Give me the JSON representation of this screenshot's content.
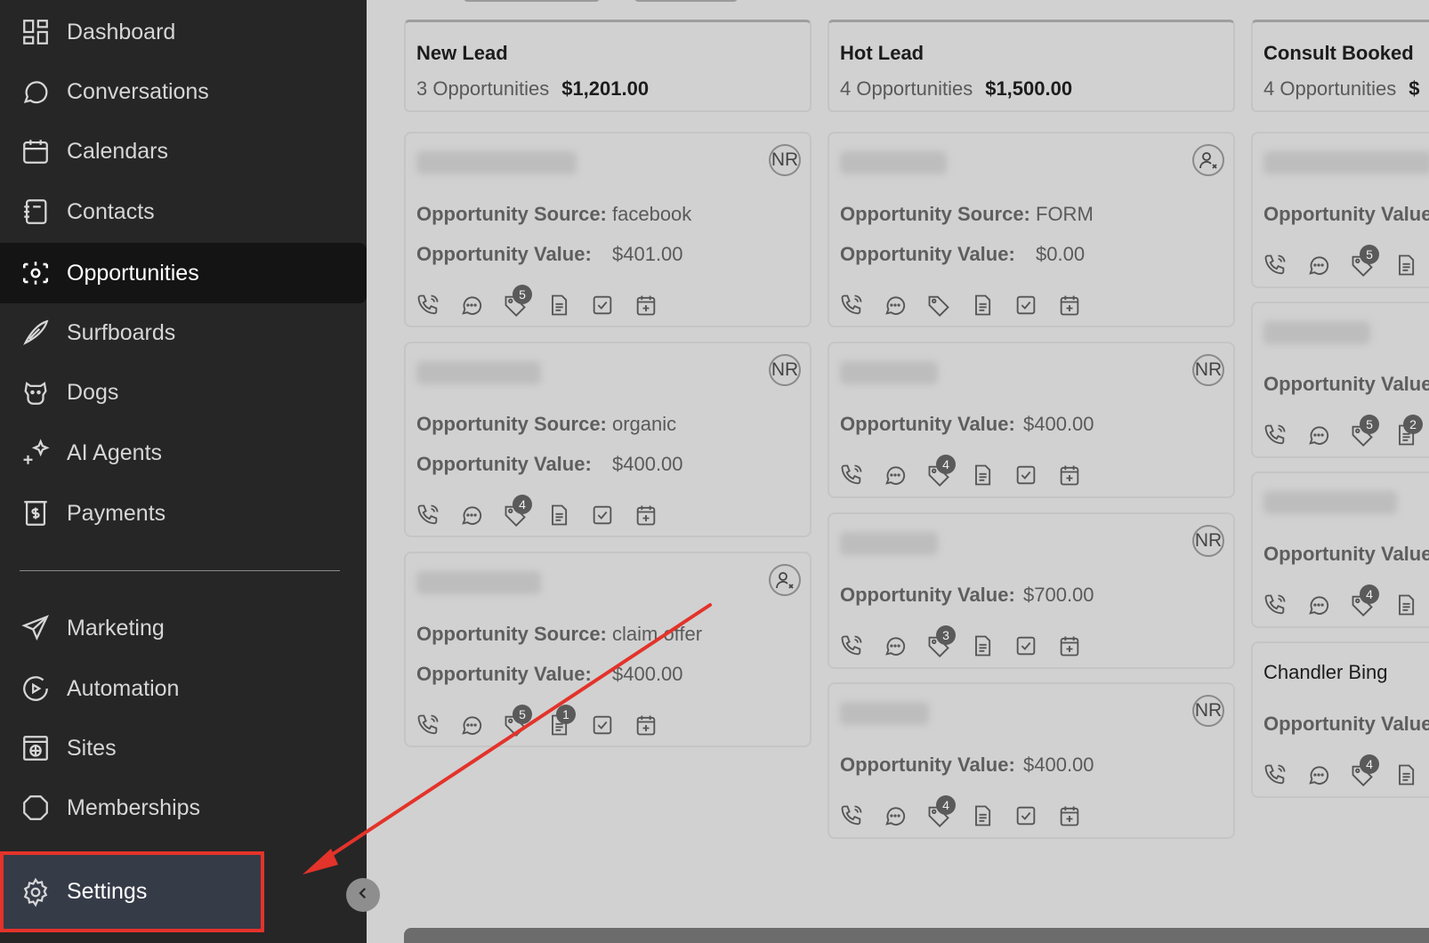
{
  "sidebar": {
    "items": [
      {
        "label": "Dashboard",
        "icon": "dashboard-icon"
      },
      {
        "label": "Conversations",
        "icon": "chat-bubble-icon"
      },
      {
        "label": "Calendars",
        "icon": "calendar-icon"
      },
      {
        "label": "Contacts",
        "icon": "contacts-book-icon"
      },
      {
        "label": "Opportunities",
        "icon": "opportunities-icon",
        "active": true
      },
      {
        "label": "Surfboards",
        "icon": "surfboard-icon"
      },
      {
        "label": "Dogs",
        "icon": "dog-icon"
      },
      {
        "label": "AI Agents",
        "icon": "sparkle-icon"
      },
      {
        "label": "Payments",
        "icon": "payments-icon"
      }
    ],
    "secondary_items": [
      {
        "label": "Marketing",
        "icon": "send-icon"
      },
      {
        "label": "Automation",
        "icon": "automation-icon"
      },
      {
        "label": "Sites",
        "icon": "sites-icon"
      },
      {
        "label": "Memberships",
        "icon": "memberships-icon"
      }
    ],
    "settings_label": "Settings"
  },
  "board": {
    "columns": [
      {
        "title": "New Lead",
        "count_text": "3 Opportunities",
        "total": "$1,201.00",
        "cards": [
          {
            "avatar": "NR",
            "source_label": "Opportunity Source:",
            "source": "facebook",
            "value_label": "Opportunity Value:",
            "value": "$401.00",
            "tag_badge": "5",
            "note_badge": ""
          },
          {
            "avatar": "NR",
            "source_label": "Opportunity Source:",
            "source": "organic",
            "value_label": "Opportunity Value:",
            "value": "$400.00",
            "tag_badge": "4",
            "note_badge": ""
          },
          {
            "avatar": "unassigned",
            "source_label": "Opportunity Source:",
            "source": "claim offer",
            "value_label": "Opportunity Value:",
            "value": "$400.00",
            "tag_badge": "5",
            "note_badge": "1"
          }
        ]
      },
      {
        "title": "Hot Lead",
        "count_text": "4 Opportunities",
        "total": "$1,500.00",
        "cards": [
          {
            "avatar": "unassigned",
            "source_label": "Opportunity Source:",
            "source": "FORM",
            "value_label": "Opportunity Value:",
            "value": "$0.00",
            "tag_badge": "",
            "note_badge": ""
          },
          {
            "avatar": "NR",
            "value_label": "Opportunity Value:",
            "value": "$400.00",
            "tag_badge": "4"
          },
          {
            "avatar": "NR",
            "value_label": "Opportunity Value:",
            "value": "$700.00",
            "tag_badge": "3"
          },
          {
            "avatar": "NR",
            "value_label": "Opportunity Value:",
            "value": "$400.00",
            "tag_badge": "4"
          }
        ]
      },
      {
        "title": "Consult Booked",
        "count_text": "4 Opportunities",
        "total": "$",
        "cards": [
          {
            "value_label": "Opportunity Value:",
            "tag_badge": "5",
            "note_badge": ""
          },
          {
            "value_label": "Opportunity Value:",
            "tag_badge": "5",
            "note_badge": "2"
          },
          {
            "value_label": "Opportunity Value:",
            "tag_badge": "4",
            "note_badge": ""
          },
          {
            "name": "Chandler Bing",
            "value_label": "Opportunity Value:",
            "tag_badge": "4",
            "note_badge": ""
          }
        ]
      }
    ]
  },
  "colors": {
    "sidebar_bg": "#262626",
    "active_item_bg": "#141414",
    "settings_bg": "#363b48",
    "highlight": "#e3332a",
    "board_bg": "#d1d1d1"
  }
}
